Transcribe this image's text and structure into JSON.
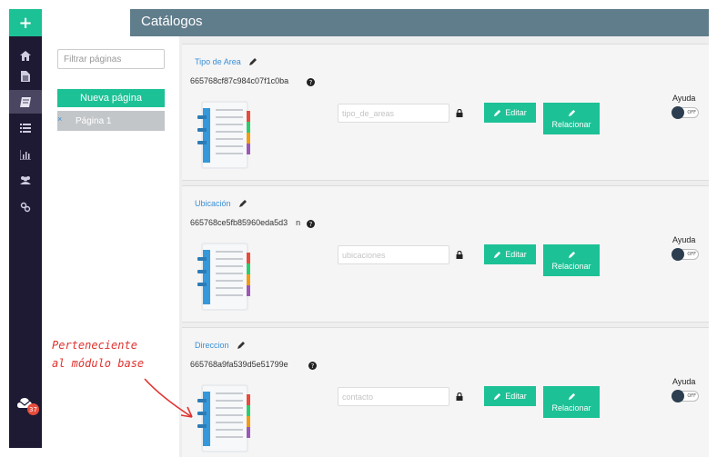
{
  "app": {
    "title": "Catálogos"
  },
  "rail": {
    "add_label": "+",
    "icons": [
      "home-icon",
      "file-icon",
      "book-icon",
      "list-icon",
      "bar-chart-icon",
      "users-icon",
      "link-icon"
    ],
    "active": "book-icon",
    "notification_count": "37"
  },
  "pages": {
    "filter_placeholder": "Filtrar páginas",
    "new_page_label": "Nueva página",
    "items": [
      {
        "remove": "×",
        "label": "Página 1"
      }
    ]
  },
  "catalogs": [
    {
      "title": "Tipo de Area",
      "id": "665768cf87c984c07f1c0ba",
      "field_placeholder": "tipo_de_areas",
      "edit_label": "Editar",
      "relate_label": "Relacionar",
      "help_label": "Ayuda",
      "toggle_state": "OFF"
    },
    {
      "title": "Ubicación",
      "id": "665768ce5fb85960eda5d3",
      "id_tail": "n",
      "field_placeholder": "ubicaciones",
      "edit_label": "Editar",
      "relate_label": "Relacionar",
      "help_label": "Ayuda",
      "toggle_state": "OFF"
    },
    {
      "title": "Direccion",
      "id": "665768a9fa539d5e51799e",
      "field_placeholder": "contacto",
      "edit_label": "Editar",
      "relate_label": "Relacionar",
      "help_label": "Ayuda",
      "toggle_state": "OFF"
    }
  ],
  "annotation": {
    "line1": "Perteneciente",
    "line2": "al módulo base"
  },
  "colors": {
    "accent": "#1dc196",
    "rail": "#1e1a33",
    "header": "#607d8b",
    "link": "#3a8fd6",
    "annotation": "#e0322f"
  }
}
